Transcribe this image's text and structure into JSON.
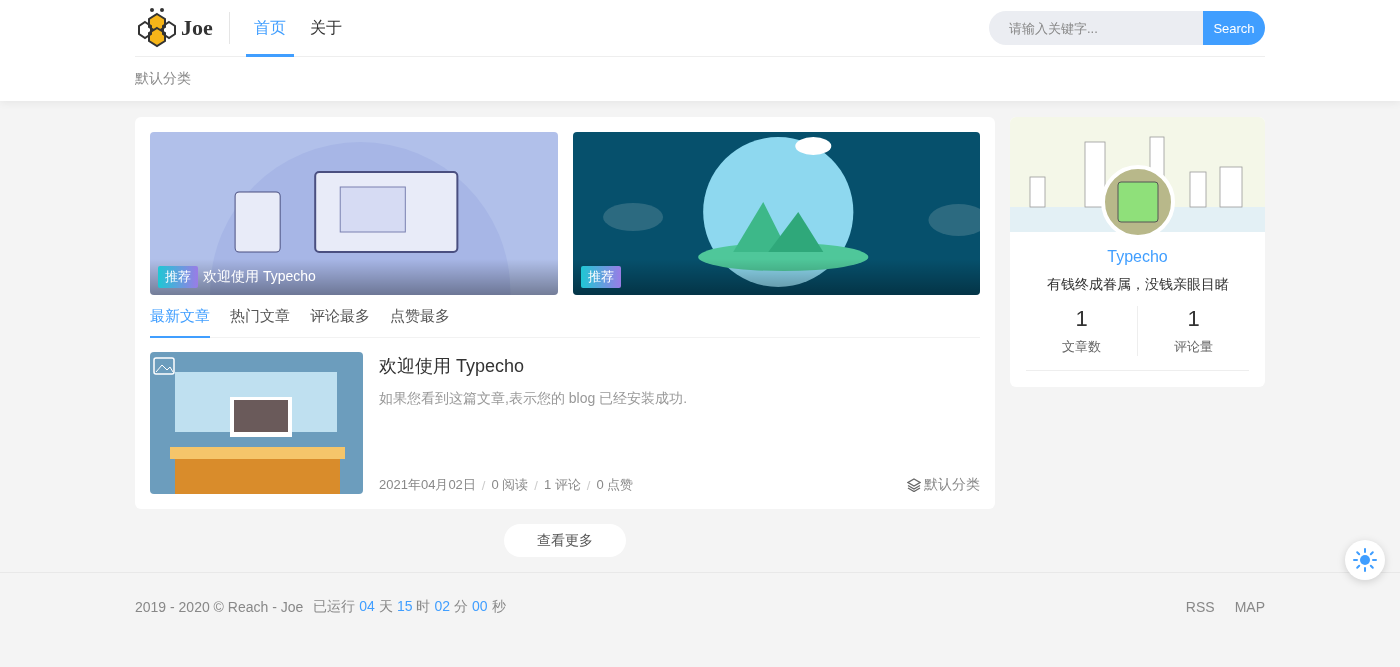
{
  "header": {
    "logo_text": "Joe",
    "nav": [
      {
        "label": "首页",
        "selected": true
      },
      {
        "label": "关于",
        "selected": false
      }
    ],
    "search": {
      "placeholder": "请输入关键字...",
      "button": "Search"
    }
  },
  "subnav": [
    "默认分类"
  ],
  "banners": [
    {
      "tag": "推荐",
      "title": "欢迎使用 Typecho",
      "kind": "laptop"
    },
    {
      "tag": "推荐",
      "kind": "island"
    }
  ],
  "tabs": [
    {
      "label": "最新文章",
      "selected": true
    },
    {
      "label": "热门文章",
      "selected": false
    },
    {
      "label": "评论最多",
      "selected": false
    },
    {
      "label": "点赞最多",
      "selected": false
    }
  ],
  "articles": [
    {
      "title": "欢迎使用 Typecho",
      "excerpt": "如果您看到这篇文章,表示您的 blog 已经安装成功.",
      "meta": [
        {
          "kind": "text",
          "text": "2021年04月02日"
        },
        {
          "kind": "sep",
          "text": "/"
        },
        {
          "kind": "text",
          "text": "0 阅读"
        },
        {
          "kind": "sep",
          "text": "/"
        },
        {
          "kind": "text",
          "text": "1 评论"
        },
        {
          "kind": "sep",
          "text": "/"
        },
        {
          "kind": "text",
          "text": "0 点赞"
        }
      ],
      "category": "默认分类"
    }
  ],
  "more_button": "查看更多",
  "profile": {
    "name": "Typecho",
    "motto": "有钱终成眷属，没钱亲眼目睹",
    "stats": [
      {
        "value": "1",
        "label": "文章数"
      },
      {
        "value": "1",
        "label": "评论量"
      }
    ]
  },
  "footer": {
    "copyright": "2019 - 2020 © Reach - Joe",
    "runtime_label": "已运行",
    "runtime": [
      {
        "value": "04",
        "unit": "天"
      },
      {
        "value": "15",
        "unit": "时"
      },
      {
        "value": "02",
        "unit": "分"
      },
      {
        "value": "00",
        "unit": "秒"
      }
    ],
    "links": [
      "RSS",
      "MAP"
    ]
  }
}
